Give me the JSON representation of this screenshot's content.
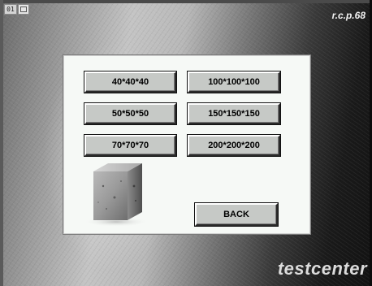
{
  "header": {
    "screen_number": "01",
    "brand_code": "r.c.p.68"
  },
  "footer": {
    "brand_name": "testcenter"
  },
  "sizes": [
    {
      "label": "40*40*40"
    },
    {
      "label": "100*100*100"
    },
    {
      "label": "50*50*50"
    },
    {
      "label": "150*150*150"
    },
    {
      "label": "70*70*70"
    },
    {
      "label": "200*200*200"
    }
  ],
  "back_label": "BACK",
  "icons": {
    "screen_tag_icon": "window-icon",
    "specimen_image": "concrete-cube-image"
  },
  "colors": {
    "panel_background": "#f6f9f6",
    "button_face": "#c6c9c6"
  }
}
